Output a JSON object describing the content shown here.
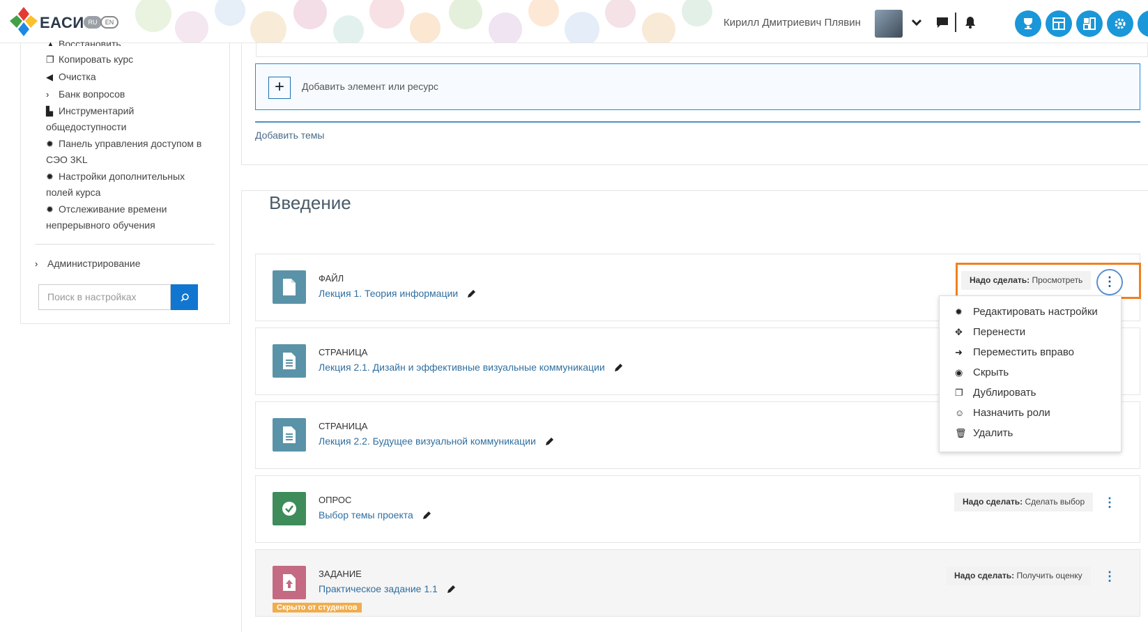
{
  "header": {
    "brand": "ЕАСИ",
    "lang_ru": "RU",
    "lang_en": "EN",
    "user_name": "Кирилл Дмитриевич Плявин"
  },
  "sidebar": {
    "items": [
      {
        "label": "Восстановить",
        "icon": "restore-icon"
      },
      {
        "label": "Копировать курс",
        "icon": "copy-icon"
      },
      {
        "label": "Очистка",
        "icon": "arrow-left-icon"
      },
      {
        "label": "Банк вопросов",
        "icon": "chevron-right-icon"
      },
      {
        "label": "Инструментарий общедоступности",
        "icon": "chart-icon"
      },
      {
        "label": "Панель управления доступом в СЭО 3KL",
        "icon": "gear-icon"
      },
      {
        "label": "Настройки дополнительных полей курса",
        "icon": "gear-icon"
      },
      {
        "label": "Отслеживание времени непрерывного обучения",
        "icon": "gear-icon"
      }
    ],
    "admin_label": "Администрирование",
    "search_placeholder": "Поиск в настройках"
  },
  "main": {
    "add_element_label": "Добавить элемент или ресурс",
    "add_topics_label": "Добавить темы",
    "section_title": "Введение",
    "activities": [
      {
        "type": "ФАЙЛ",
        "name": "Лекция 1. Теория информации",
        "todo_label": "Надо сделать:",
        "todo_value": "Просмотреть",
        "color": "#5a93a8"
      },
      {
        "type": "СТРАНИЦА",
        "name": "Лекция 2.1. Дизайн и эффективные визуальные коммуникации",
        "todo_label": "",
        "todo_value": "",
        "color": "#5a93a8"
      },
      {
        "type": "СТРАНИЦА",
        "name": "Лекция 2.2. Будущее визуальной коммуникации",
        "todo_label": "",
        "todo_value": "",
        "color": "#5a93a8"
      },
      {
        "type": "ОПРОС",
        "name": "Выбор темы проекта",
        "todo_label": "Надо сделать:",
        "todo_value": "Сделать выбор",
        "color": "#3d8c5a"
      },
      {
        "type": "ЗАДАНИЕ",
        "name": "Практическое задание 1.1",
        "todo_label": "Надо сделать:",
        "todo_value": "Получить оценку",
        "color": "#c46a82",
        "hidden_tag": "Скрыто от студентов"
      }
    ]
  },
  "dropdown": {
    "items": [
      {
        "label": "Редактировать настройки",
        "icon": "gear-icon"
      },
      {
        "label": "Перенести",
        "icon": "move-icon"
      },
      {
        "label": "Переместить вправо",
        "icon": "arrow-right-icon"
      },
      {
        "label": "Скрыть",
        "icon": "eye-icon"
      },
      {
        "label": "Дублировать",
        "icon": "copy-icon"
      },
      {
        "label": "Назначить роли",
        "icon": "user-icon"
      },
      {
        "label": "Удалить",
        "icon": "trash-icon"
      }
    ]
  },
  "colors": {
    "accent": "#1a97d8",
    "highlight": "#f08020",
    "link": "#2f6fa0"
  }
}
